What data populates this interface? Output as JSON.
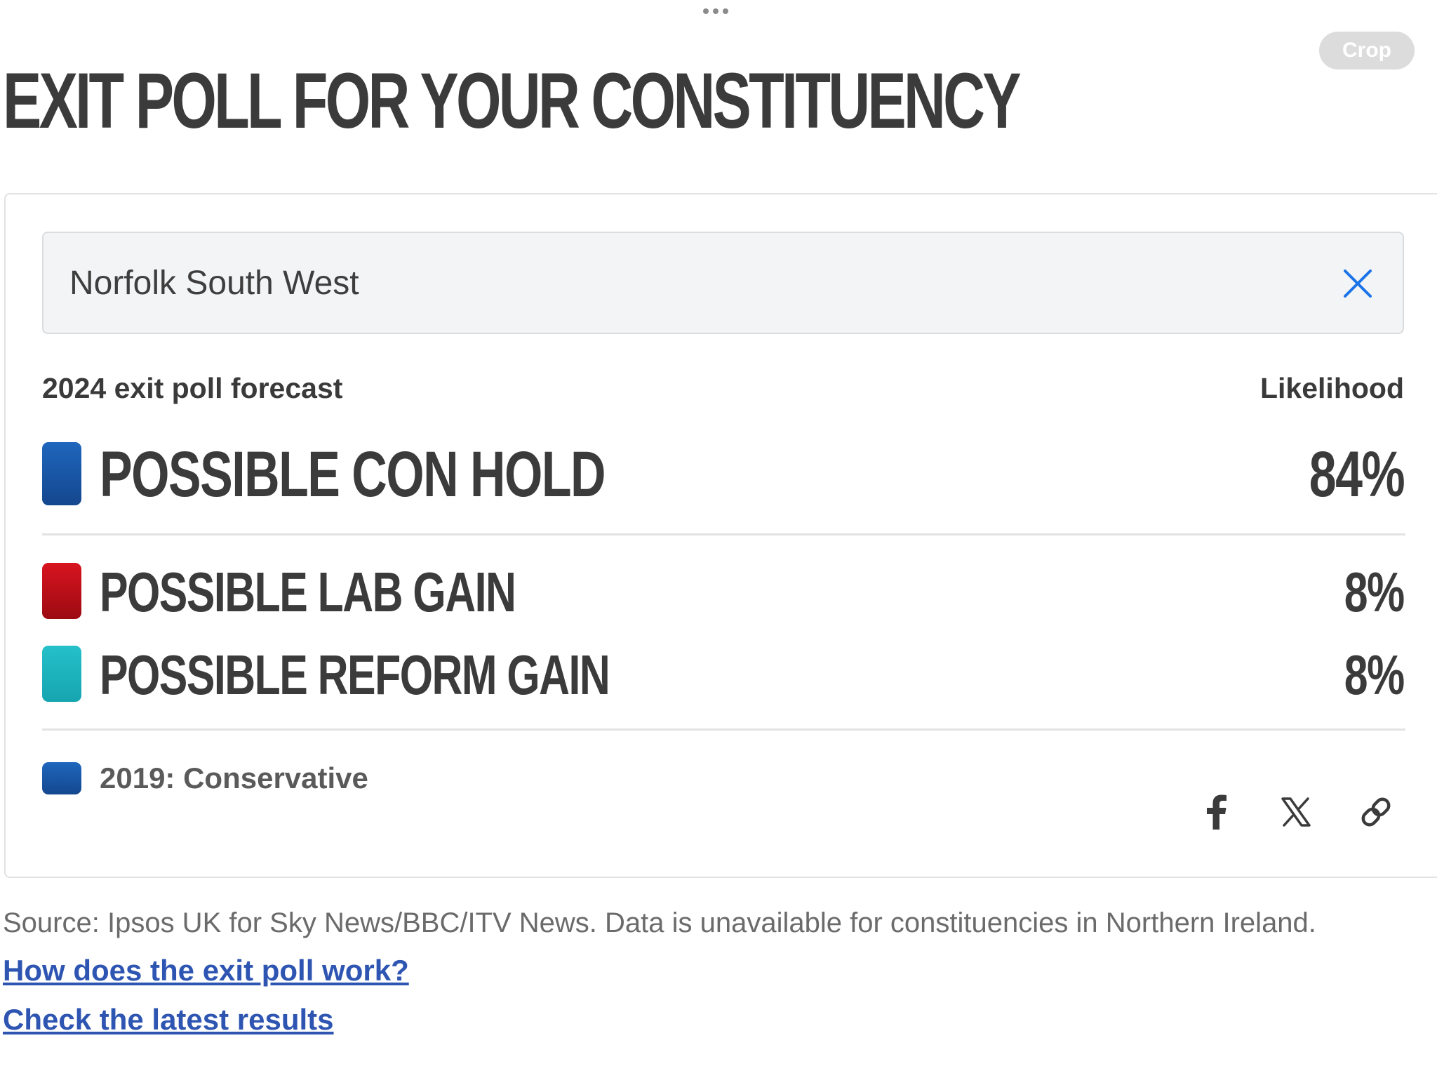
{
  "toolbar": {
    "crop_label": "Crop"
  },
  "title": "EXIT POLL FOR YOUR CONSTITUENCY",
  "search": {
    "value": "Norfolk South West",
    "clear_icon": "close-icon"
  },
  "forecast": {
    "heading": "2024 exit poll forecast",
    "likelihood_heading": "Likelihood",
    "results": [
      {
        "label": "POSSIBLE CON HOLD",
        "value": "84%",
        "likelihood": 84,
        "color": "#1d5aa8"
      },
      {
        "label": "POSSIBLE LAB GAIN",
        "value": "8%",
        "likelihood": 8,
        "color": "#c1121f"
      },
      {
        "label": "POSSIBLE REFORM GAIN",
        "value": "8%",
        "likelihood": 8,
        "color": "#1fb3be"
      }
    ],
    "previous": {
      "label": "2019: Conservative",
      "color": "#1d5aa8"
    }
  },
  "share": {
    "icons": [
      "facebook-icon",
      "x-icon",
      "link-icon"
    ]
  },
  "footer": {
    "source": "Source: Ipsos UK for Sky News/BBC/ITV News. Data is unavailable for constituencies in Northern Ireland.",
    "link_how": "How does the exit poll work?",
    "link_results": "Check the latest results"
  }
}
